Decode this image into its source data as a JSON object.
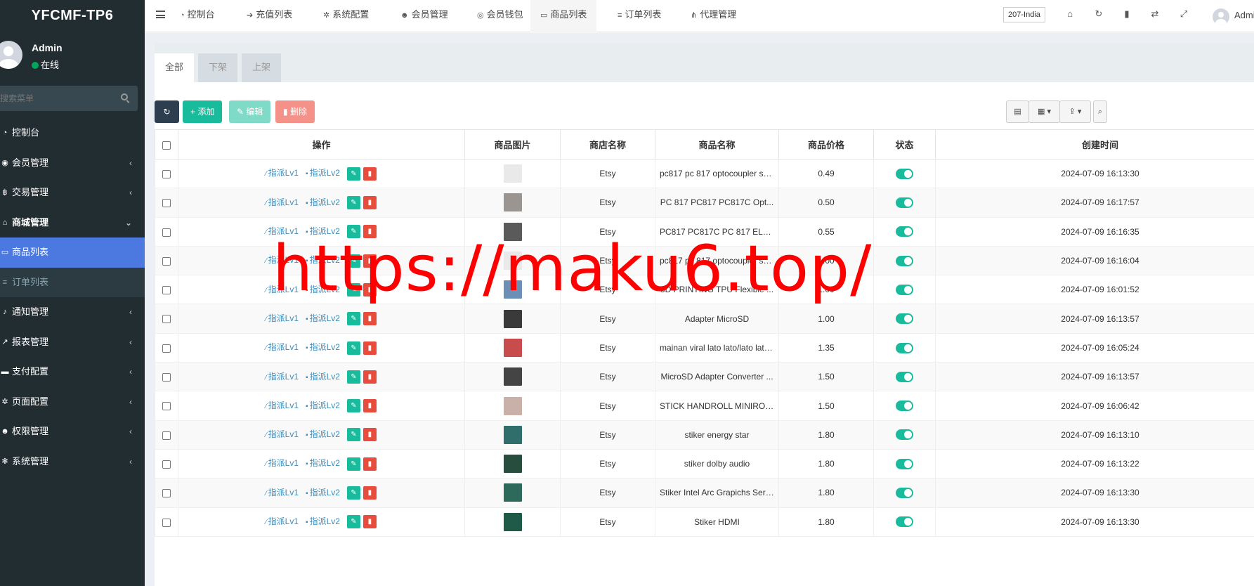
{
  "app": {
    "logo": "YFCMF-TP6"
  },
  "user": {
    "name": "Admin",
    "status": "在线"
  },
  "sidebar": {
    "search_placeholder": "搜索菜单",
    "items": [
      {
        "label": "控制台",
        "icon": "dashboard-icon",
        "expandable": false
      },
      {
        "label": "会员管理",
        "icon": "user-circle-icon",
        "expandable": true
      },
      {
        "label": "交易管理",
        "icon": "bitcoin-icon",
        "expandable": true
      },
      {
        "label": "商城管理",
        "icon": "home-icon",
        "expandable": true,
        "open": true
      },
      {
        "label": "商品列表",
        "icon": "monitor-icon",
        "active": true
      },
      {
        "label": "订单列表",
        "icon": "list-icon",
        "sub": true
      },
      {
        "label": "通知管理",
        "icon": "bell-icon",
        "expandable": true
      },
      {
        "label": "报表管理",
        "icon": "chart-icon",
        "expandable": true
      },
      {
        "label": "支付配置",
        "icon": "credit-card-icon",
        "expandable": true
      },
      {
        "label": "页面配置",
        "icon": "gear-icon",
        "expandable": true
      },
      {
        "label": "权限管理",
        "icon": "users-icon",
        "expandable": true
      },
      {
        "label": "系统管理",
        "icon": "cogs-icon",
        "expandable": true
      }
    ]
  },
  "topnav": {
    "tabs": [
      {
        "label": "控制台",
        "icon": "dashboard-icon"
      },
      {
        "label": "充值列表",
        "icon": "arrow-right-icon"
      },
      {
        "label": "系统配置",
        "icon": "gear-icon"
      },
      {
        "label": "会员管理",
        "icon": "user-icon"
      },
      {
        "label": "会员钱包",
        "icon": "wallet-icon"
      },
      {
        "label": "商品列表",
        "icon": "monitor-icon",
        "active": true
      },
      {
        "label": "订单列表",
        "icon": "list-icon"
      },
      {
        "label": "代理管理",
        "icon": "sitemap-icon"
      }
    ],
    "lang": "207-India",
    "admin": "Admin"
  },
  "panel": {
    "tabs": [
      "全部",
      "下架",
      "上架"
    ],
    "buttons": {
      "add": "添加",
      "edit": "编辑",
      "delete": "删除"
    }
  },
  "table": {
    "headers": [
      "操作",
      "商品图片",
      "商店名称",
      "商品名称",
      "商品价格",
      "状态",
      "创建时间"
    ],
    "action_lv1": "指派Lv1",
    "action_lv2": "指派Lv2",
    "rows": [
      {
        "shop": "Etsy",
        "name": "pc817 pc 817 optocoupler sh...",
        "price": "0.49",
        "created": "2024-07-09 16:13:30",
        "thumb_color": "#e9e9e9"
      },
      {
        "shop": "Etsy",
        "name": "PC 817 PC817 PC817C Opt...",
        "price": "0.50",
        "created": "2024-07-09 16:17:57",
        "thumb_color": "#9a9590"
      },
      {
        "shop": "Etsy",
        "name": "PC817 PC817C PC 817 EL8...",
        "price": "0.55",
        "created": "2024-07-09 16:16:35",
        "thumb_color": "#5a5a5a"
      },
      {
        "shop": "Etsy",
        "name": "pc817 pc 817 optocoupler sh...",
        "price": "1.00",
        "created": "2024-07-09 16:16:04",
        "thumb_color": "#e9e9e9"
      },
      {
        "shop": "Etsy",
        "name": "3D PRINTING TPU Flexible ...",
        "price": "1.00",
        "created": "2024-07-09 16:01:52",
        "thumb_color": "#6c8fb5"
      },
      {
        "shop": "Etsy",
        "name": "Adapter MicroSD",
        "price": "1.00",
        "created": "2024-07-09 16:13:57",
        "thumb_color": "#3a3a3a"
      },
      {
        "shop": "Etsy",
        "name": "mainan viral lato lato/lato lato...",
        "price": "1.35",
        "created": "2024-07-09 16:05:24",
        "thumb_color": "#c94c4c"
      },
      {
        "shop": "Etsy",
        "name": "MicroSD Adapter Converter ...",
        "price": "1.50",
        "created": "2024-07-09 16:13:57",
        "thumb_color": "#444444"
      },
      {
        "shop": "Etsy",
        "name": "STICK HANDROLL MINIROL...",
        "price": "1.50",
        "created": "2024-07-09 16:06:42",
        "thumb_color": "#c9b0a8"
      },
      {
        "shop": "Etsy",
        "name": "stiker energy star",
        "price": "1.80",
        "created": "2024-07-09 16:13:10",
        "thumb_color": "#2f6e6a"
      },
      {
        "shop": "Etsy",
        "name": "stiker dolby audio",
        "price": "1.80",
        "created": "2024-07-09 16:13:22",
        "thumb_color": "#264d3e"
      },
      {
        "shop": "Etsy",
        "name": "Stiker Intel Arc Grapichs Series",
        "price": "1.80",
        "created": "2024-07-09 16:13:30",
        "thumb_color": "#2d6a5b"
      },
      {
        "shop": "Etsy",
        "name": "Stiker HDMI",
        "price": "1.80",
        "created": "2024-07-09 16:13:30",
        "thumb_color": "#1f5a48"
      }
    ]
  },
  "watermark": "https://maku6.top/",
  "colors": {
    "sidebar_bg": "#222d32",
    "active_menu": "#4c79df",
    "accent": "#18bc9c",
    "danger": "#e74c3c"
  }
}
